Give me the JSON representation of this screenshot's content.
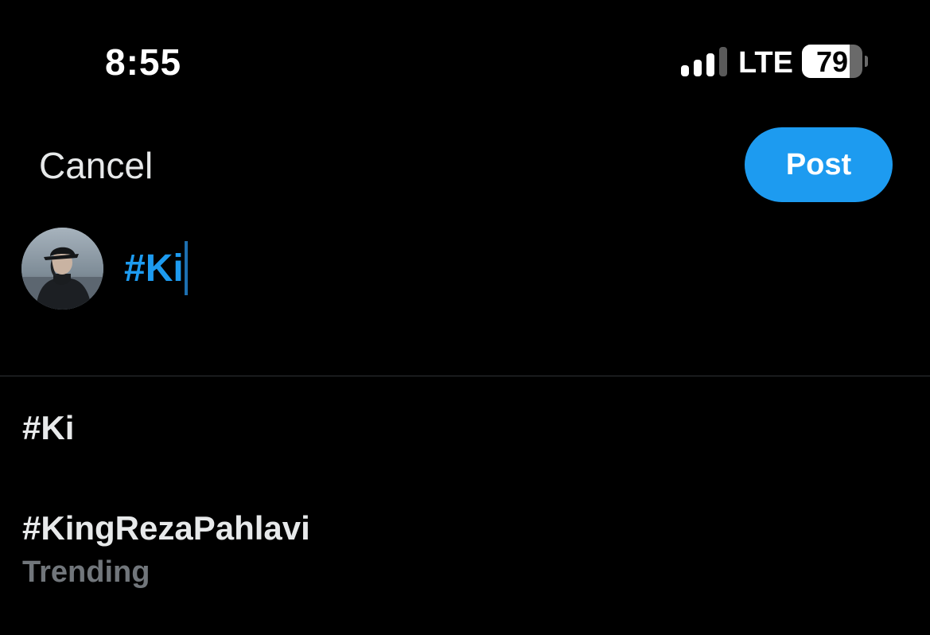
{
  "status_bar": {
    "time": "8:55",
    "network": "LTE",
    "signal_bars_active": 3,
    "signal_bars_total": 4,
    "battery_percent": 79,
    "battery_label": "79"
  },
  "header": {
    "cancel_label": "Cancel",
    "post_label": "Post"
  },
  "composer": {
    "text": "#Ki"
  },
  "suggestions": [
    {
      "tag": "#Ki",
      "subtitle": ""
    },
    {
      "tag": "#KingRezaPahlavi",
      "subtitle": "Trending"
    }
  ],
  "colors": {
    "accent": "#1d9bf0",
    "background": "#000000",
    "text_primary": "#e7e9ea",
    "text_secondary": "#71767b",
    "divider": "#2f3336"
  }
}
